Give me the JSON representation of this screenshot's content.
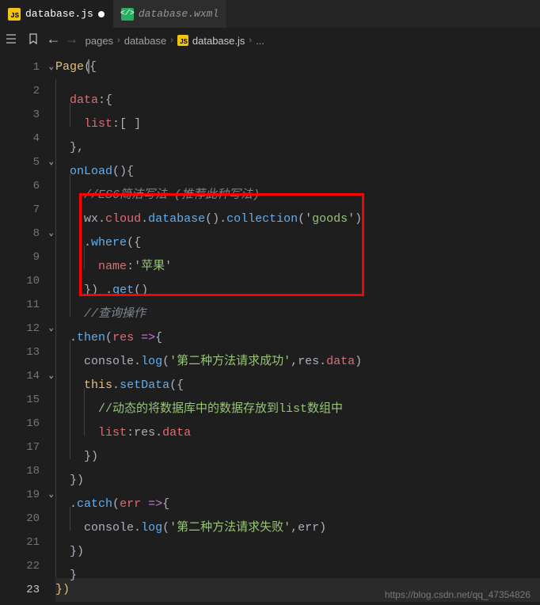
{
  "tabs": [
    {
      "label": "database.js",
      "active": true,
      "icon": "js",
      "modified": true
    },
    {
      "label": "database.wxml",
      "active": false,
      "icon": "wxml",
      "modified": false
    }
  ],
  "breadcrumb": {
    "parts": [
      "pages",
      "database",
      "database.js",
      "..."
    ],
    "icon_at": 2
  },
  "code_lines": [
    {
      "n": 1,
      "fold": true,
      "indent": 0,
      "html": "<span class='fn'>Page</span><span class='punc'>(</span><span class='cursor-box'></span><span class='punc'>{</span>"
    },
    {
      "n": 2,
      "fold": false,
      "indent": 1,
      "html": "<span class='key'>data</span><span class='punc'>:{</span>"
    },
    {
      "n": 3,
      "fold": false,
      "indent": 2,
      "html": "<span class='key'>list</span><span class='punc'>:[</span> <span class='punc'>]</span>"
    },
    {
      "n": 4,
      "fold": false,
      "indent": 1,
      "html": "<span class='punc'>},</span>"
    },
    {
      "n": 5,
      "fold": true,
      "indent": 1,
      "html": "<span class='call'>onLoad</span><span class='punc'>(){</span>"
    },
    {
      "n": 6,
      "fold": false,
      "indent": 2,
      "html": "<span class='comment'>//ES6简洁写法 (推荐此种写法)</span>"
    },
    {
      "n": 7,
      "fold": false,
      "indent": 2,
      "html": "<span class='var'>wx</span><span class='punc'>.</span><span class='key'>cloud</span><span class='punc'>.</span><span class='call'>database</span><span class='punc'>().</span><span class='call'>collection</span><span class='punc'>(</span><span class='str'>'goods'</span><span class='punc'>)</span>"
    },
    {
      "n": 8,
      "fold": true,
      "indent": 2,
      "html": "<span class='punc'>.</span><span class='call'>where</span><span class='punc'>({</span>"
    },
    {
      "n": 9,
      "fold": false,
      "indent": 3,
      "html": "<span class='key'>name</span><span class='punc'>:</span><span class='str'>'苹果'</span>"
    },
    {
      "n": 10,
      "fold": false,
      "indent": 2,
      "html": "<span class='punc'>})</span> <span class='punc'>.</span><span class='call'>get</span><span class='punc'>()</span>"
    },
    {
      "n": 11,
      "fold": false,
      "indent": 2,
      "html": "<span class='comment'>//查询操作</span>"
    },
    {
      "n": 12,
      "fold": true,
      "indent": 1,
      "html": "<span class='punc'>.</span><span class='call'>then</span><span class='punc'>(</span><span class='key'>res</span> <span class='kw'>=&gt;</span><span class='punc'>{</span>"
    },
    {
      "n": 13,
      "fold": false,
      "indent": 2,
      "html": "<span class='var'>console</span><span class='punc'>.</span><span class='call'>log</span><span class='punc'>(</span><span class='str'>'第二种方法请求成功'</span><span class='punc'>,</span><span class='var'>res</span><span class='punc'>.</span><span class='key'>data</span><span class='punc'>)</span>"
    },
    {
      "n": 14,
      "fold": true,
      "indent": 2,
      "html": "<span class='this'>this</span><span class='punc'>.</span><span class='call'>setData</span><span class='punc'>({</span>"
    },
    {
      "n": 15,
      "fold": false,
      "indent": 3,
      "html": "<span class='comment-green'>//动态的将数据库中的数据存放到list数组中</span>"
    },
    {
      "n": 16,
      "fold": false,
      "indent": 3,
      "html": "<span class='key'>list</span><span class='punc'>:</span><span class='var'>res</span><span class='punc'>.</span><span class='key'>data</span>"
    },
    {
      "n": 17,
      "fold": false,
      "indent": 2,
      "html": "<span class='punc'>})</span>"
    },
    {
      "n": 18,
      "fold": false,
      "indent": 1,
      "html": "<span class='punc'>})</span>"
    },
    {
      "n": 19,
      "fold": true,
      "indent": 1,
      "html": "<span class='punc'>.</span><span class='call'>catch</span><span class='punc'>(</span><span class='key'>err</span> <span class='kw'>=&gt;</span><span class='punc'>{</span>"
    },
    {
      "n": 20,
      "fold": false,
      "indent": 2,
      "html": "<span class='var'>console</span><span class='punc'>.</span><span class='call'>log</span><span class='punc'>(</span><span class='str'>'第二种方法请求失败'</span><span class='punc'>,</span><span class='var'>err</span><span class='punc'>)</span>"
    },
    {
      "n": 21,
      "fold": false,
      "indent": 1,
      "html": "<span class='punc'>})</span>"
    },
    {
      "n": 22,
      "fold": false,
      "indent": 1,
      "html": "<span class='punc'>}</span>"
    },
    {
      "n": 23,
      "fold": false,
      "indent": 0,
      "html": "<span class='fn'>})</span>",
      "current": true
    }
  ],
  "highlight_box": {
    "from_line": 7,
    "to_line": 10
  },
  "watermark": "https://blog.csdn.net/qq_47354826",
  "icon_labels": {
    "js": "JS",
    "wxml": "</>"
  }
}
